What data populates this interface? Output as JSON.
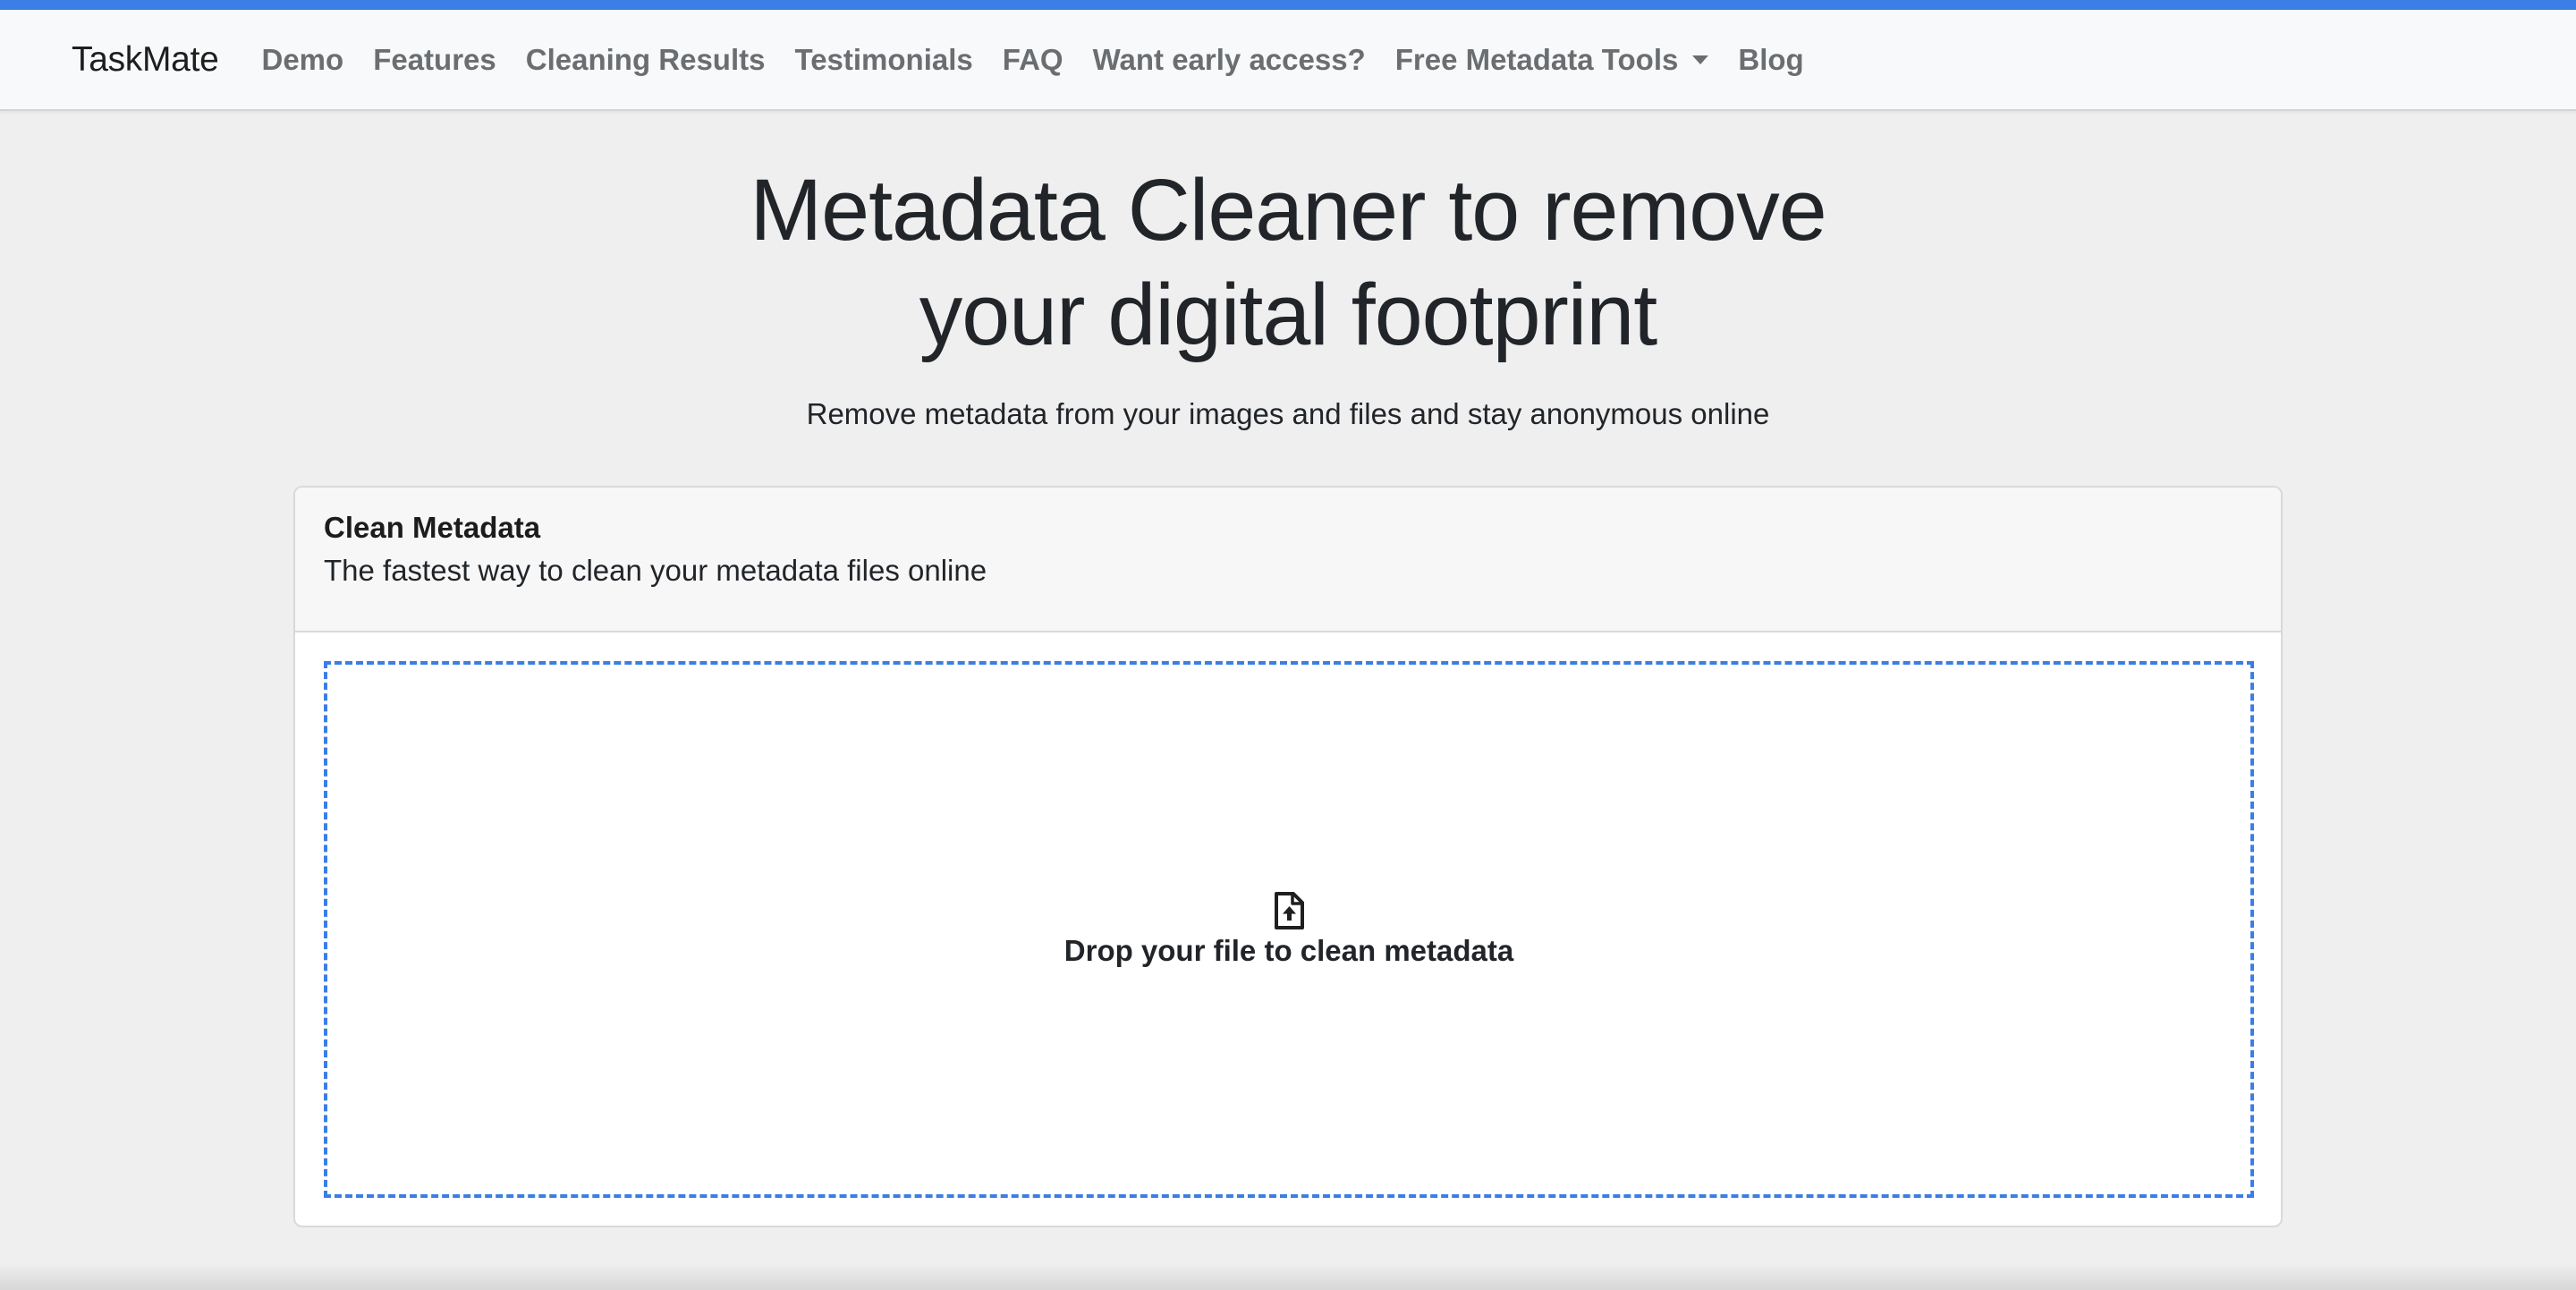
{
  "colors": {
    "accent": "#3a7ee6",
    "page_background": "#efefef",
    "navbar_background": "#f8f9fa",
    "nav_link": "#6b6e71",
    "text_dark": "#212529"
  },
  "navbar": {
    "brand": "TaskMate",
    "items": [
      {
        "label": "Demo"
      },
      {
        "label": "Features"
      },
      {
        "label": "Cleaning Results"
      },
      {
        "label": "Testimonials"
      },
      {
        "label": "FAQ"
      },
      {
        "label": "Want early access?"
      },
      {
        "label": "Free Metadata Tools",
        "dropdown": true
      },
      {
        "label": "Blog"
      }
    ]
  },
  "hero": {
    "title_line1": "Metadata Cleaner to remove",
    "title_line2": "your digital footprint",
    "subtitle": "Remove metadata from your images and files and stay anonymous online"
  },
  "card": {
    "title": "Clean Metadata",
    "subtitle": "The fastest way to clean your metadata files online",
    "dropzone": {
      "icon": "file-upload-icon",
      "text": "Drop your file to clean metadata"
    }
  }
}
